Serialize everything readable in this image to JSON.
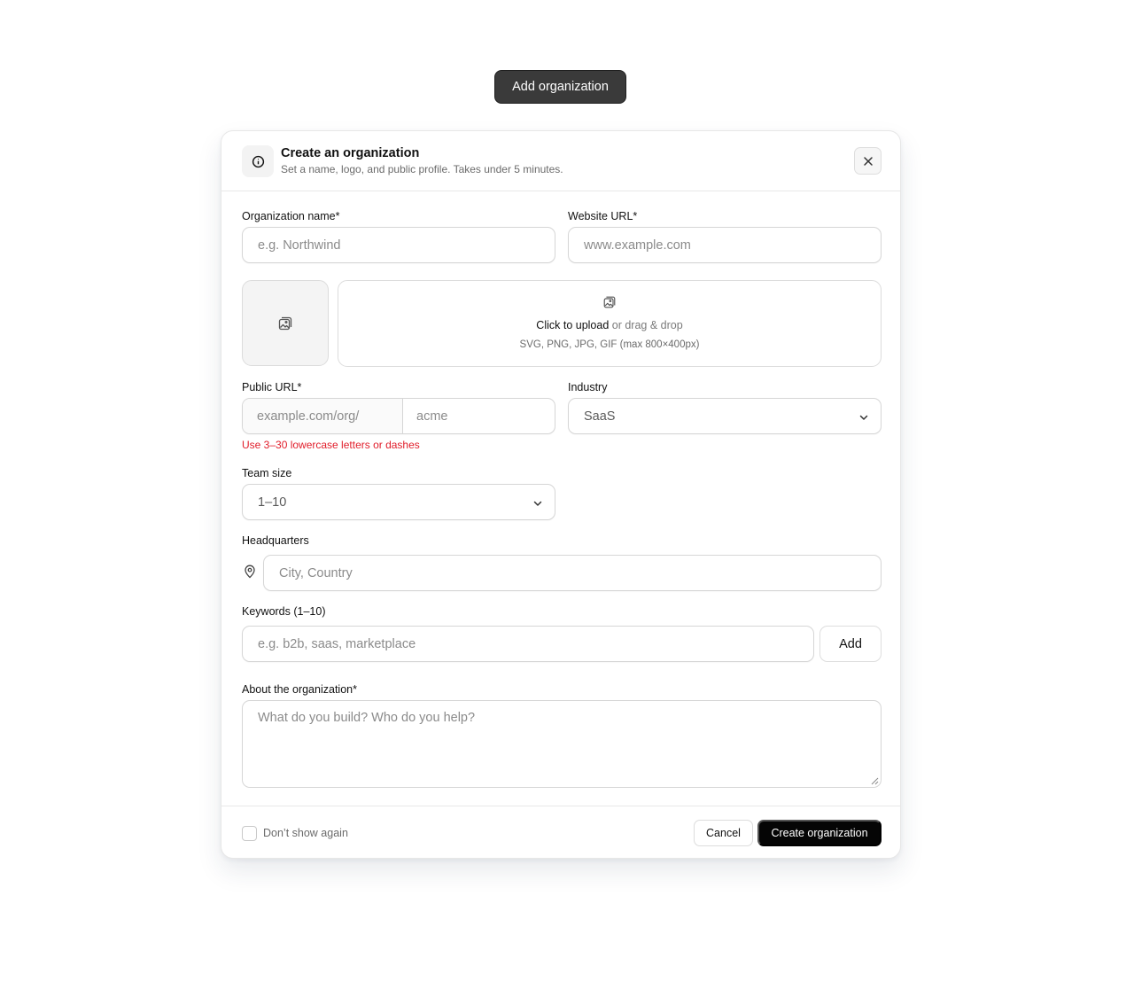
{
  "trigger": {
    "label": "Add organization"
  },
  "dialog": {
    "header": {
      "icon": "info-icon",
      "title": "Create an organization",
      "subtitle": "Set a name, logo, and public profile. Takes under 5 minutes.",
      "close_icon": "close-icon"
    },
    "fields": {
      "org_name": {
        "label": "Organization name*",
        "placeholder": "e.g. Northwind"
      },
      "website": {
        "label": "Website URL*",
        "placeholder": "www.example.com"
      },
      "logo": {
        "preview_icon": "image-icon",
        "upload_icon": "image-icon",
        "upload_strong": "Click to upload",
        "upload_rest": " or drag & drop",
        "upload_hint": "SVG, PNG, JPG, GIF (max 800×400px)"
      },
      "public_url": {
        "label": "Public URL*",
        "prefix": "example.com/org/",
        "placeholder": "acme",
        "error": "Use 3–30 lowercase letters or dashes"
      },
      "industry": {
        "label": "Industry",
        "value": "SaaS"
      },
      "team_size": {
        "label": "Team size",
        "value": "1–10"
      },
      "headquarters": {
        "label": "Headquarters",
        "icon": "map-pin-icon",
        "placeholder": "City, Country"
      },
      "keywords": {
        "label": "Keywords (1–10)",
        "placeholder": "e.g. b2b, saas, marketplace",
        "add_label": "Add"
      },
      "about": {
        "label": "About the organization*",
        "placeholder": "What do you build? Who do you help?"
      }
    },
    "footer": {
      "checkbox_label": "Don’t show again",
      "checked": false,
      "cancel_label": "Cancel",
      "create_label": "Create organization"
    }
  },
  "colors": {
    "primary": "#050505",
    "trigger_bg": "#3a3a3a",
    "error": "#e11d2a",
    "border": "#d6d6d6"
  }
}
